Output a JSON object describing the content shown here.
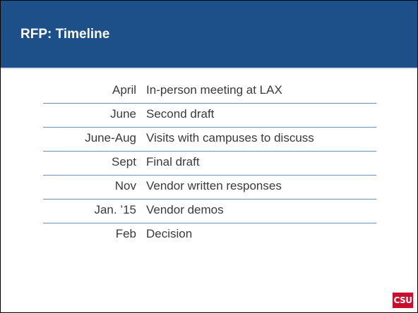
{
  "slide": {
    "title": "RFP: Timeline"
  },
  "timeline": {
    "rows": [
      {
        "date": "April",
        "event": "In-person meeting at LAX"
      },
      {
        "date": "June",
        "event": "Second draft"
      },
      {
        "date": "June-Aug",
        "event": "Visits with campuses to discuss"
      },
      {
        "date": "Sept",
        "event": "Final draft"
      },
      {
        "date": "Nov",
        "event": "Vendor written responses"
      },
      {
        "date": "Jan. ’15",
        "event": "Vendor demos"
      },
      {
        "date": "Feb",
        "event": "Decision"
      }
    ]
  },
  "logo": {
    "text": "CSU"
  },
  "colors": {
    "title_bar": "#1d4f88",
    "divider": "#6f8fb5",
    "logo": "#c8102e"
  }
}
